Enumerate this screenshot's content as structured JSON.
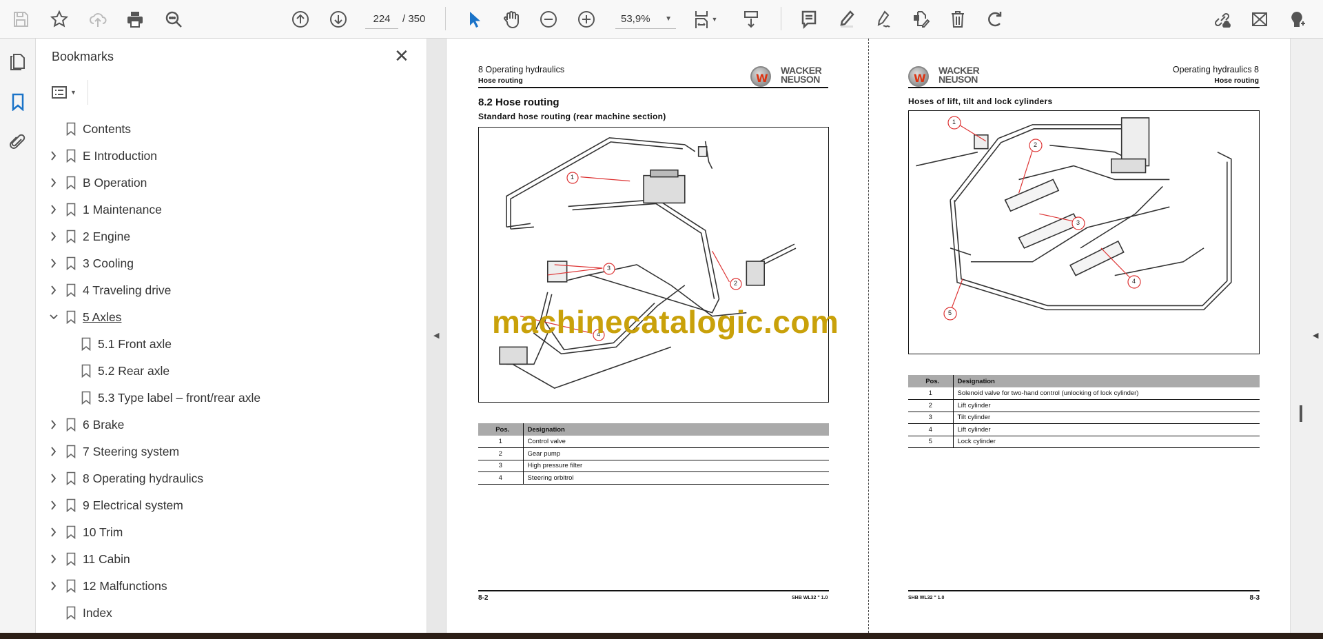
{
  "toolbar": {
    "left_icons": [
      "save-icon",
      "bookmark-star-icon",
      "cloud-upload-icon",
      "print-icon",
      "search-zoom-icon"
    ],
    "page_current": "224",
    "page_total": "/ 350",
    "zoom_value": "53,9%",
    "tool_icons": [
      "page-up-icon",
      "page-down-icon",
      "select-cursor-icon",
      "hand-icon",
      "zoom-out-icon",
      "zoom-in-icon",
      "fit-page-icon",
      "scroll-mode-icon",
      "comment-icon",
      "highlight-icon",
      "sign-icon",
      "edit-pdf-icon",
      "delete-icon",
      "rotate-icon",
      "share-link-icon",
      "email-icon",
      "add-user-icon"
    ],
    "accent": "#1a73c8"
  },
  "rail": {
    "icons": [
      "pages-icon",
      "bookmarks-icon",
      "attachments-icon"
    ],
    "active": "bookmarks-icon"
  },
  "bookmarks": {
    "title": "Bookmarks",
    "items": [
      {
        "label": "Contents",
        "level": 0,
        "expander": "none"
      },
      {
        "label": "E Introduction",
        "level": 0,
        "expander": "collapsed"
      },
      {
        "label": "B Operation",
        "level": 0,
        "expander": "collapsed"
      },
      {
        "label": "1 Maintenance",
        "level": 0,
        "expander": "collapsed"
      },
      {
        "label": "2 Engine",
        "level": 0,
        "expander": "collapsed"
      },
      {
        "label": "3 Cooling",
        "level": 0,
        "expander": "collapsed"
      },
      {
        "label": "4 Traveling drive",
        "level": 0,
        "expander": "collapsed"
      },
      {
        "label": "5 Axles",
        "level": 0,
        "expander": "expanded",
        "current": true
      },
      {
        "label": "5.1 Front axle",
        "level": 1,
        "expander": "none"
      },
      {
        "label": "5.2 Rear axle",
        "level": 1,
        "expander": "none"
      },
      {
        "label": "5.3 Type label – front/rear axle",
        "level": 1,
        "expander": "none"
      },
      {
        "label": "6 Brake",
        "level": 0,
        "expander": "collapsed"
      },
      {
        "label": "7 Steering system",
        "level": 0,
        "expander": "collapsed"
      },
      {
        "label": "8 Operating hydraulics",
        "level": 0,
        "expander": "collapsed"
      },
      {
        "label": "9 Electrical system",
        "level": 0,
        "expander": "collapsed"
      },
      {
        "label": "10 Trim",
        "level": 0,
        "expander": "collapsed"
      },
      {
        "label": "11 Cabin",
        "level": 0,
        "expander": "collapsed"
      },
      {
        "label": "12 Malfunctions",
        "level": 0,
        "expander": "collapsed"
      },
      {
        "label": "Index",
        "level": 0,
        "expander": "none"
      }
    ]
  },
  "left_page": {
    "chapter": "8   Operating hydraulics",
    "subheader": "Hose routing",
    "logo_text": [
      "WACKER",
      "NEUSON"
    ],
    "section": "8.2      Hose routing",
    "figure_title": "Standard hose routing (rear machine section)",
    "callouts": [
      "1",
      "2",
      "3",
      "4"
    ],
    "table": {
      "headers": [
        "Pos.",
        "Designation"
      ],
      "rows": [
        [
          "1",
          "Control valve"
        ],
        [
          "2",
          "Gear pump"
        ],
        [
          "3",
          "High pressure filter"
        ],
        [
          "4",
          "Steering orbitrol"
        ]
      ]
    },
    "footer_page": "8-2",
    "footer_doc": "SHB WL32 \" 1.0"
  },
  "right_page": {
    "chapter": "Operating hydraulics   8",
    "subheader": "Hose routing",
    "logo_text": [
      "WACKER",
      "NEUSON"
    ],
    "figure_title": "Hoses of lift, tilt and lock cylinders",
    "callouts": [
      "1",
      "2",
      "3",
      "4",
      "5"
    ],
    "table": {
      "headers": [
        "Pos.",
        "Designation"
      ],
      "rows": [
        [
          "1",
          "Solenoid valve for two-hand control (unlocking of lock cylinder)"
        ],
        [
          "2",
          "Lift cylinder"
        ],
        [
          "3",
          "Tilt cylinder"
        ],
        [
          "4",
          "Lift cylinder"
        ],
        [
          "5",
          "Lock cylinder"
        ]
      ]
    },
    "footer_page": "8-3",
    "footer_doc": "SHB WL32 \" 1.0"
  },
  "watermark": {
    "text": "machinecatalogic.com",
    "color": "#c9a10a"
  }
}
